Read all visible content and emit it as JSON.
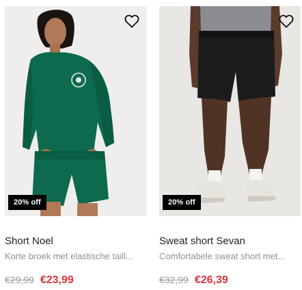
{
  "products": [
    {
      "title": "Short Noel",
      "subtitle": "Korte broek met elastische taill...",
      "badge": "20% off",
      "old_price": "€29,99",
      "new_price": "€23,99"
    },
    {
      "title": "Sweat short Sevan",
      "subtitle": "Comfortabele sweat short met...",
      "badge": "20% off",
      "old_price": "€32,99",
      "new_price": "€26,39"
    }
  ],
  "icons": {
    "wishlist": "heart-outline-icon"
  },
  "colors": {
    "badge_bg": "#000000",
    "sale_price": "#e0323a",
    "old_price": "#9b9b9b",
    "image_bg": "#efeeec",
    "product_green": "#0e6a4f",
    "shorts_black": "#1c1c1e"
  }
}
